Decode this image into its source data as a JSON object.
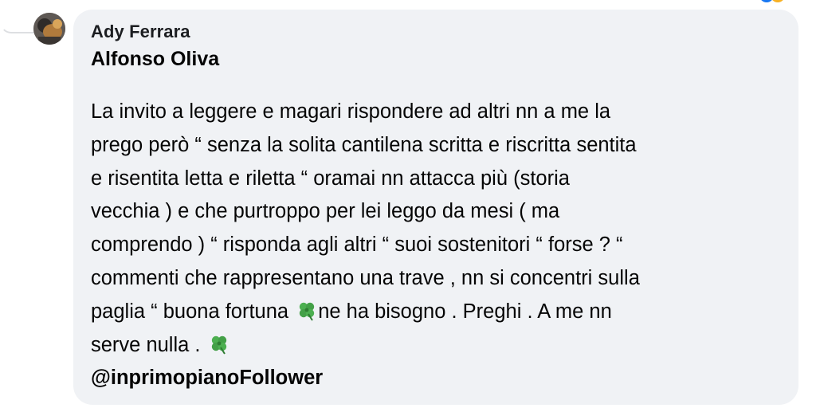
{
  "comment": {
    "author_name": "Ady Ferrara",
    "mention_reply_to": "Alfonso Oliva",
    "text_lines": [
      "La invito a leggere e magari rispondere ad altri nn a me la",
      "prego però “ senza la solita cantilena scritta e riscritta sentita",
      "e risentita letta e riletta “ oramai nn attacca più (storia",
      "vecchia ) e che purtroppo per lei leggo da mesi ( ma",
      "comprendo ) “ risponda agli altri “ suoi sostenitori “ forse ? “",
      "commenti che rappresentano una trave , nn si concentri sulla"
    ],
    "line_7_before_icon": "paglia “ buona fortuna ",
    "line_7_after_icon": "ne ha bisogno . Preghi . A me nn",
    "line_8_before_icon": "serve nulla . ",
    "clover_icon": "four-leaf-clover-emoji",
    "mention_tag": "@inprimopianoFollower"
  },
  "colors": {
    "bubble_bg": "#f0f2f5",
    "text": "#050505",
    "clover": "#4caf50"
  }
}
